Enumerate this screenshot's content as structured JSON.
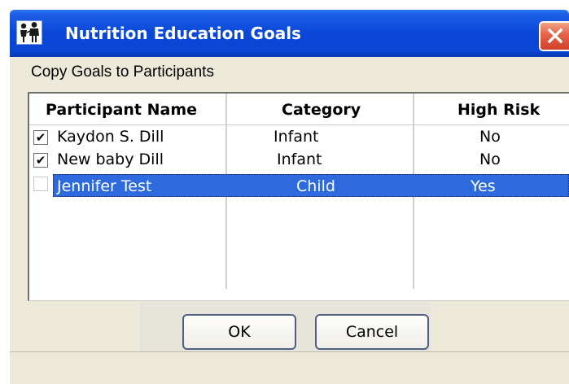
{
  "window": {
    "title": "Nutrition Education Goals",
    "icon": "family-icon"
  },
  "section_label": "Copy Goals to Participants",
  "table": {
    "columns": [
      "Participant Name",
      "Category",
      "High Risk"
    ],
    "rows": [
      {
        "checked": "✔",
        "name": "Kaydon S. Dill",
        "category": "Infant",
        "high_risk": "No"
      },
      {
        "checked": "✔",
        "name": "New baby Dill",
        "category": "Infant",
        "high_risk": "No"
      },
      {
        "checked": "",
        "name": "Jennifer Test",
        "category": "Child",
        "high_risk": "Yes",
        "selected": true
      }
    ]
  },
  "buttons": {
    "ok": "OK",
    "cancel": "Cancel"
  },
  "colors": {
    "titlebar": "#0a47d8",
    "selection": "#2d6ade",
    "close": "#d1412a"
  }
}
